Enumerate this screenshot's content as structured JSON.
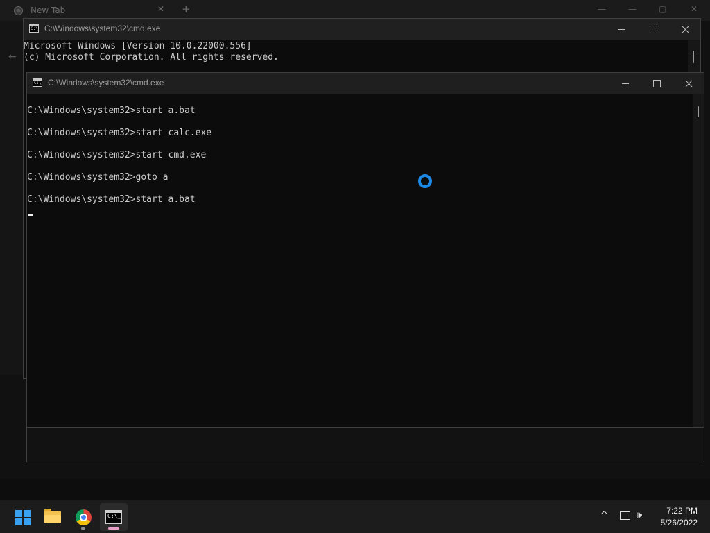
{
  "browser": {
    "tab_title": "New Tab",
    "tab_close": "✕",
    "new_tab": "+",
    "back": "←"
  },
  "cmd_back": {
    "title": "C:\\Windows\\system32\\cmd.exe",
    "lines": [
      "Microsoft Windows [Version 10.0.22000.556]",
      "(c) Microsoft Corporation. All rights reserved."
    ]
  },
  "cmd_front": {
    "title": "C:\\Windows\\system32\\cmd.exe",
    "lines": [
      "C:\\Windows\\system32>start a.bat",
      "C:\\Windows\\system32>start calc.exe",
      "C:\\Windows\\system32>start cmd.exe",
      "C:\\Windows\\system32>goto a",
      "C:\\Windows\\system32>start a.bat"
    ]
  },
  "taskbar": {
    "apps": [
      {
        "name": "start",
        "icon": "windows-logo-icon"
      },
      {
        "name": "file-explorer",
        "icon": "folder-icon"
      },
      {
        "name": "chrome",
        "icon": "chrome-icon"
      },
      {
        "name": "command-prompt",
        "icon": "terminal-icon"
      }
    ],
    "term_icon_glyph": "C:\\_",
    "tray_chevron": "^",
    "volume_glyph": "🕪",
    "time": "7:22 PM",
    "date": "5/26/2022"
  },
  "colors": {
    "console_text": "#cccccc",
    "console_bg": "#0c0c0c",
    "busy_spinner": "#1e88e5",
    "windows_logo": "#3aa0f0"
  }
}
